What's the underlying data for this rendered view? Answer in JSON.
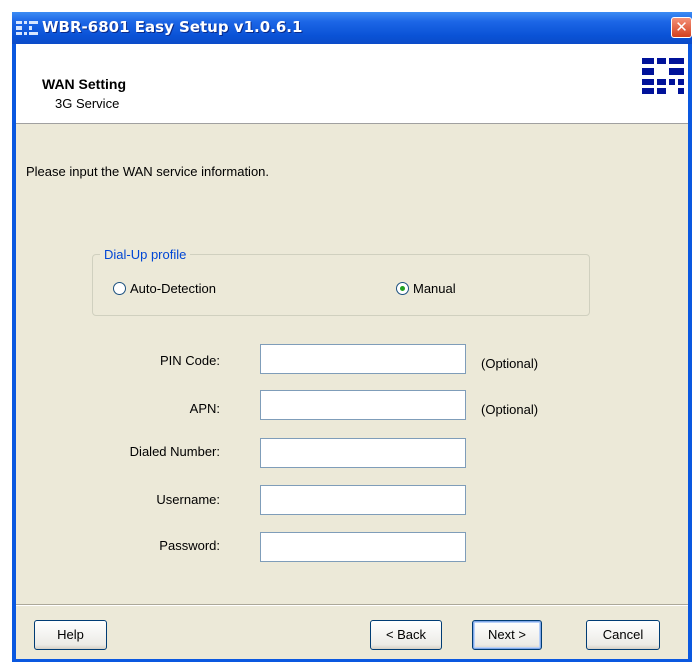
{
  "window": {
    "title": "WBR-6801 Easy Setup v1.0.6.1",
    "close_glyph": "✕"
  },
  "header": {
    "title": "WAN Setting",
    "subtitle": "3G Service",
    "logo_icon": "brand-logo-icon"
  },
  "intro_text": "Please input the WAN service information.",
  "dialup_profile": {
    "legend": "Dial-Up profile",
    "options": [
      {
        "label": "Auto-Detection",
        "selected": false
      },
      {
        "label": "Manual",
        "selected": true
      }
    ]
  },
  "fields": [
    {
      "label": "PIN Code:",
      "value": "",
      "hint": "(Optional)"
    },
    {
      "label": "APN:",
      "value": "",
      "hint": "(Optional)"
    },
    {
      "label": "Dialed Number:",
      "value": ""
    },
    {
      "label": "Username:",
      "value": ""
    },
    {
      "label": "Password:",
      "value": ""
    }
  ],
  "buttons": {
    "help": "Help",
    "back": "< Back",
    "next": "Next >",
    "cancel": "Cancel"
  },
  "colors": {
    "titlebar_blue": "#0a52d6",
    "window_frame": "#0a58e0",
    "dialog_face": "#ece9d8",
    "group_legend": "#0046d5",
    "close_red": "#d2401e"
  }
}
